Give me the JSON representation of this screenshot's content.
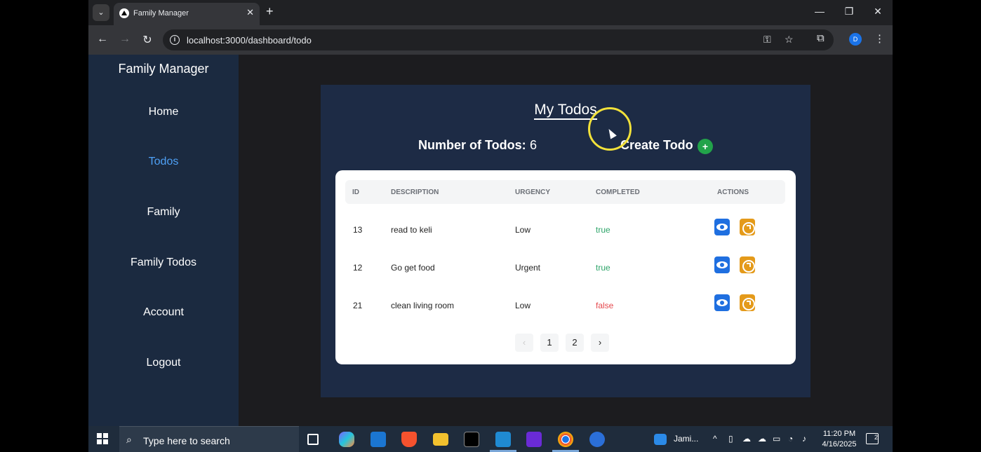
{
  "browser": {
    "tab_title": "Family Manager",
    "url": "localhost:3000/dashboard/todo",
    "profile_initial": "D"
  },
  "sidebar": {
    "brand": "Family Manager",
    "items": [
      {
        "label": "Home",
        "active": false
      },
      {
        "label": "Todos",
        "active": true
      },
      {
        "label": "Family",
        "active": false
      },
      {
        "label": "Family Todos",
        "active": false
      },
      {
        "label": "Account",
        "active": false
      },
      {
        "label": "Logout",
        "active": false
      }
    ]
  },
  "main": {
    "title": "My Todos",
    "count_label": "Number of Todos:",
    "count_value": "6",
    "create_label": "Create Todo",
    "table": {
      "headers": [
        "ID",
        "DESCRIPTION",
        "URGENCY",
        "COMPLETED",
        "ACTIONS"
      ],
      "rows": [
        {
          "id": "13",
          "description": "read to keli",
          "urgency": "Low",
          "completed": "true"
        },
        {
          "id": "12",
          "description": "Go get food",
          "urgency": "Urgent",
          "completed": "true"
        },
        {
          "id": "21",
          "description": "clean living room",
          "urgency": "Low",
          "completed": "false"
        }
      ]
    },
    "pagination": {
      "prev": "‹",
      "pages": [
        "1",
        "2"
      ],
      "next": "›"
    }
  },
  "taskbar": {
    "search_placeholder": "Type here to search",
    "app_label": "Jami...",
    "time": "11:20 PM",
    "date": "4/16/2025",
    "notification_count": "2"
  },
  "colors": {
    "sidebar_bg": "#1b2a40",
    "panel_bg": "#1d2b45",
    "active_nav": "#4ea0f5",
    "true_color": "#2fa56a",
    "false_color": "#e5484d",
    "view_button": "#1f6fe0",
    "edit_button": "#e49a1a",
    "create_button": "#22a34a"
  }
}
